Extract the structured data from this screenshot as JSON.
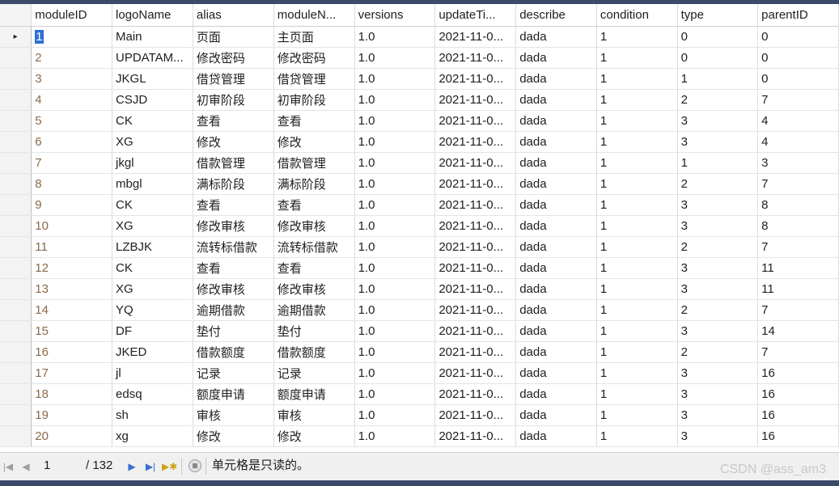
{
  "columns": [
    "moduleID",
    "logoName",
    "alias",
    "moduleN...",
    "versions",
    "updateTi...",
    "describe",
    "condition",
    "type",
    "parentID"
  ],
  "rows": [
    [
      "1",
      "Main",
      "页面",
      "主页面",
      "1.0",
      "2021-11-0...",
      "dada",
      "1",
      "0",
      "0"
    ],
    [
      "2",
      "UPDATAM...",
      "修改密码",
      "修改密码",
      "1.0",
      "2021-11-0...",
      "dada",
      "1",
      "0",
      "0"
    ],
    [
      "3",
      "JKGL",
      "借贷管理",
      "借贷管理",
      "1.0",
      "2021-11-0...",
      "dada",
      "1",
      "1",
      "0"
    ],
    [
      "4",
      "CSJD",
      "初审阶段",
      "初审阶段",
      "1.0",
      "2021-11-0...",
      "dada",
      "1",
      "2",
      "7"
    ],
    [
      "5",
      "CK",
      "查看",
      "查看",
      "1.0",
      "2021-11-0...",
      "dada",
      "1",
      "3",
      "4"
    ],
    [
      "6",
      "XG",
      "修改",
      "修改",
      "1.0",
      "2021-11-0...",
      "dada",
      "1",
      "3",
      "4"
    ],
    [
      "7",
      "jkgl",
      "借款管理",
      "借款管理",
      "1.0",
      "2021-11-0...",
      "dada",
      "1",
      "1",
      "3"
    ],
    [
      "8",
      "mbgl",
      "满标阶段",
      "满标阶段",
      "1.0",
      "2021-11-0...",
      "dada",
      "1",
      "2",
      "7"
    ],
    [
      "9",
      "CK",
      "查看",
      "查看",
      "1.0",
      "2021-11-0...",
      "dada",
      "1",
      "3",
      "8"
    ],
    [
      "10",
      "XG",
      "修改审核",
      "修改审核",
      "1.0",
      "2021-11-0...",
      "dada",
      "1",
      "3",
      "8"
    ],
    [
      "11",
      "LZBJK",
      "流转标借款",
      "流转标借款",
      "1.0",
      "2021-11-0...",
      "dada",
      "1",
      "2",
      "7"
    ],
    [
      "12",
      "CK",
      "查看",
      "查看",
      "1.0",
      "2021-11-0...",
      "dada",
      "1",
      "3",
      "11"
    ],
    [
      "13",
      "XG",
      "修改审核",
      "修改审核",
      "1.0",
      "2021-11-0...",
      "dada",
      "1",
      "3",
      "11"
    ],
    [
      "14",
      "YQ",
      "逾期借款",
      "逾期借款",
      "1.0",
      "2021-11-0...",
      "dada",
      "1",
      "2",
      "7"
    ],
    [
      "15",
      "DF",
      "垫付",
      "垫付",
      "1.0",
      "2021-11-0...",
      "dada",
      "1",
      "3",
      "14"
    ],
    [
      "16",
      "JKED",
      "借款额度",
      "借款额度",
      "1.0",
      "2021-11-0...",
      "dada",
      "1",
      "2",
      "7"
    ],
    [
      "17",
      "jl",
      "记录",
      "记录",
      "1.0",
      "2021-11-0...",
      "dada",
      "1",
      "3",
      "16"
    ],
    [
      "18",
      "edsq",
      "额度申请",
      "额度申请",
      "1.0",
      "2021-11-0...",
      "dada",
      "1",
      "3",
      "16"
    ],
    [
      "19",
      "sh",
      "审核",
      "审核",
      "1.0",
      "2021-11-0...",
      "dada",
      "1",
      "3",
      "16"
    ],
    [
      "20",
      "xg",
      "修改",
      "修改",
      "1.0",
      "2021-11-0...",
      "dada",
      "1",
      "3",
      "16"
    ]
  ],
  "current_row_marker": "▸",
  "statusbar": {
    "first_icon": "first-record-icon",
    "prev_icon": "previous-record-icon",
    "position_value": "1",
    "total": "/ 132",
    "next_icon": "next-record-icon",
    "last_icon": "last-record-icon",
    "new_icon": "new-record-icon",
    "stop_icon": "stop-icon",
    "message": "单元格是只读的。"
  },
  "watermark": "CSDN @ass_am3",
  "colors": {
    "selection": "#2f6fd6",
    "id_text": "#8a6a4a",
    "nav_icon": "#3a6fcf",
    "frame": "#3b4a6b"
  }
}
